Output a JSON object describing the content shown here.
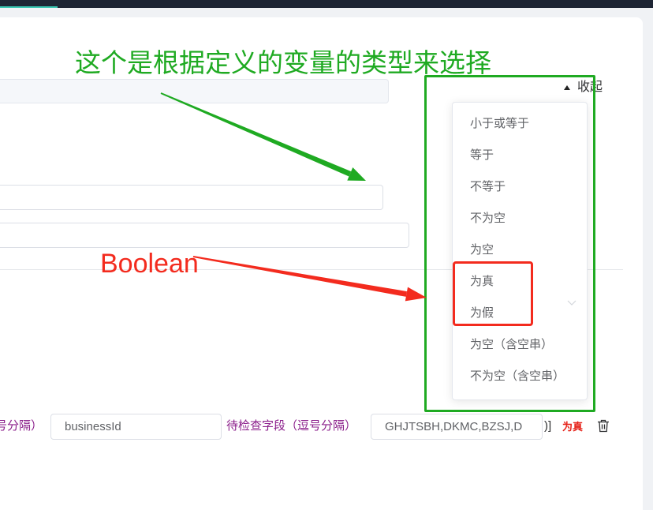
{
  "header": {
    "accent_color": "#3cc8b4"
  },
  "filter_panel": {
    "collapse_label": "收起",
    "collapse_icon": "caret-up-icon"
  },
  "annotations": {
    "green_text": "这个是根据定义的变量的类型来选择",
    "red_text": "Boolean",
    "green_color": "#1faa22",
    "red_color": "#f32b1e"
  },
  "operator_dropdown": {
    "options": [
      "小于或等于",
      "等于",
      "不等于",
      "不为空",
      "为空",
      "为真",
      "为假",
      "为空（含空串）",
      "不为空（含空串）"
    ],
    "chevron_icon": "chevron-down-icon"
  },
  "rule_row": {
    "prefix_label": "号分隔）",
    "field_input_value": "businessId",
    "check_fields_label": "待检查字段（逗号分隔）",
    "check_fields_value": "GHJTSBH,DKMC,BZSJ,D",
    "closing": ")]",
    "condition_badge": "为真",
    "delete_icon": "trash-icon"
  }
}
